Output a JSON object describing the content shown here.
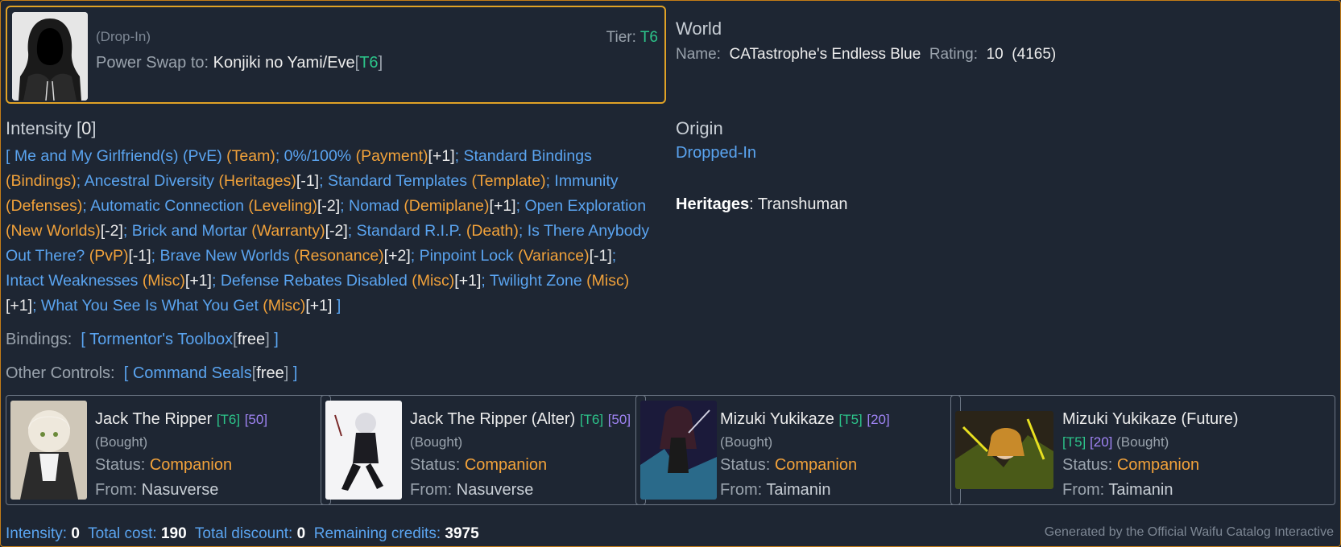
{
  "player": {
    "dropin": "(Drop-In)",
    "tier_label": "Tier:",
    "tier_value": "T6",
    "swap_label": "Power Swap to:",
    "swap_name": "Konjiki no Yami/Eve",
    "swap_tier": "T6"
  },
  "world": {
    "title": "World",
    "name_label": "Name:",
    "name_value": "CATastrophe's Endless Blue",
    "rating_label": "Rating:",
    "rating_value": "10",
    "rating_extra": "(4165)"
  },
  "intensity": {
    "title": "Intensity",
    "value": "0",
    "items": [
      {
        "name": "Me and My Girlfriend(s) (PvE)",
        "cat": "(Team)",
        "mod": ""
      },
      {
        "name": "0%/100%",
        "cat": "(Payment)",
        "mod": "+1"
      },
      {
        "name": "Standard Bindings",
        "cat": "(Bindings)",
        "mod": ""
      },
      {
        "name": "Ancestral Diversity",
        "cat": "(Heritages)",
        "mod": "-1"
      },
      {
        "name": "Standard Templates",
        "cat": "(Template)",
        "mod": ""
      },
      {
        "name": "Immunity",
        "cat": "(Defenses)",
        "mod": ""
      },
      {
        "name": "Automatic Connection",
        "cat": "(Leveling)",
        "mod": "-2"
      },
      {
        "name": "Nomad",
        "cat": "(Demiplane)",
        "mod": "+1"
      },
      {
        "name": "Open Exploration",
        "cat": "(New Worlds)",
        "mod": "-2"
      },
      {
        "name": "Brick and Mortar",
        "cat": "(Warranty)",
        "mod": "-2"
      },
      {
        "name": "Standard R.I.P.",
        "cat": "(Death)",
        "mod": ""
      },
      {
        "name": "Is There Anybody Out There?",
        "cat": "(PvP)",
        "mod": "-1"
      },
      {
        "name": "Brave New Worlds",
        "cat": "(Resonance)",
        "mod": "+2"
      },
      {
        "name": "Pinpoint Lock",
        "cat": "(Variance)",
        "mod": "-1"
      },
      {
        "name": "Intact Weaknesses",
        "cat": "(Misc)",
        "mod": "+1"
      },
      {
        "name": "Defense Rebates Disabled",
        "cat": "(Misc)",
        "mod": "+1"
      },
      {
        "name": "Twilight Zone",
        "cat": "(Misc)",
        "mod": "+1"
      },
      {
        "name": "What You See Is What You Get",
        "cat": "(Misc)",
        "mod": "+1"
      }
    ]
  },
  "origin": {
    "title": "Origin",
    "value": "Dropped-In",
    "heritages_label": "Heritages",
    "heritages_value": "Transhuman"
  },
  "bindings": {
    "label": "Bindings:",
    "item": "Tormentor's Toolbox",
    "cost": "free"
  },
  "controls": {
    "label": "Other Controls:",
    "item": "Command Seals",
    "cost": "free"
  },
  "companions": [
    {
      "name": "Jack The Ripper",
      "tier": "[T6]",
      "cost": "[50]",
      "bought": "(Bought)",
      "status_label": "Status:",
      "status": "Companion",
      "from_label": "From:",
      "from": "Nasuverse"
    },
    {
      "name": "Jack The Ripper (Alter)",
      "tier": "[T6]",
      "cost": "[50]",
      "bought": "(Bought)",
      "status_label": "Status:",
      "status": "Companion",
      "from_label": "From:",
      "from": "Nasuverse"
    },
    {
      "name": "Mizuki Yukikaze",
      "tier": "[T5]",
      "cost": "[20]",
      "bought": "(Bought)",
      "status_label": "Status:",
      "status": "Companion",
      "from_label": "From:",
      "from": "Taimanin"
    },
    {
      "name": "Mizuki Yukikaze (Future)",
      "tier": "[T5]",
      "cost": "[20]",
      "bought": "(Bought)",
      "status_label": "Status:",
      "status": "Companion",
      "from_label": "From:",
      "from": "Taimanin"
    }
  ],
  "footer": {
    "intensity_label": "Intensity:",
    "intensity_value": "0",
    "total_cost_label": "Total cost:",
    "total_cost_value": "190",
    "discount_label": "Total discount:",
    "discount_value": "0",
    "remaining_label": "Remaining credits:",
    "remaining_value": "3975",
    "credit": "Generated by the Official Waifu Catalog Interactive"
  },
  "colors": {
    "background": "#1e2633",
    "accent_border": "#e0a226",
    "link_blue": "#5aa4f0",
    "category_orange": "#f2a23a",
    "tier_green": "#2cc48a",
    "cost_purple": "#a084f5"
  }
}
